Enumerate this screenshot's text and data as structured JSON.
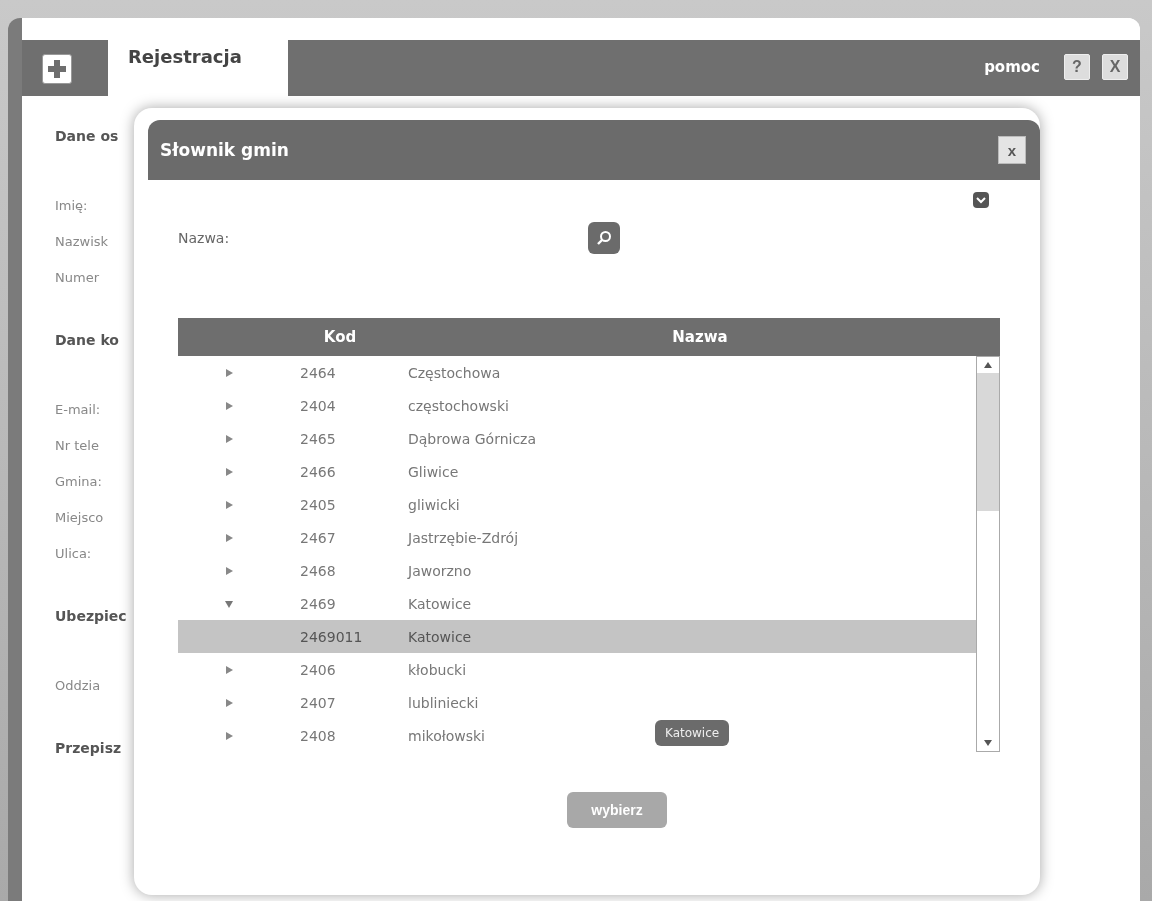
{
  "window": {
    "title": "Rejestracja",
    "help_link": "pomoc",
    "help_button": "?",
    "close_button": "X"
  },
  "form": {
    "sections": [
      {
        "heading": "Dane os",
        "labels": [
          "Imię:",
          "Nazwisk",
          "Numer"
        ]
      },
      {
        "heading": "Dane ko",
        "labels": [
          "E-mail:",
          "Nr tele",
          "Gmina:",
          "Miejsco",
          "Ulica:"
        ]
      },
      {
        "heading": "Ubezpiec",
        "labels": [
          "Oddzia"
        ]
      },
      {
        "heading": "Przepisz"
      }
    ]
  },
  "dialog": {
    "title": "Słownik gmin",
    "close_button": "x",
    "search": {
      "label": "Nazwa:"
    },
    "table": {
      "columns": [
        "",
        "Kod",
        "Nazwa"
      ],
      "rows": [
        {
          "code": "2464",
          "name": "Częstochowa",
          "expanded": false,
          "selected": false
        },
        {
          "code": "2404",
          "name": "częstochowski",
          "expanded": false,
          "selected": false
        },
        {
          "code": "2465",
          "name": "Dąbrowa Górnicza",
          "expanded": false,
          "selected": false
        },
        {
          "code": "2466",
          "name": "Gliwice",
          "expanded": false,
          "selected": false
        },
        {
          "code": "2405",
          "name": "gliwicki",
          "expanded": false,
          "selected": false
        },
        {
          "code": "2467",
          "name": "Jastrzębie-Zdrój",
          "expanded": false,
          "selected": false
        },
        {
          "code": "2468",
          "name": "Jaworzno",
          "expanded": false,
          "selected": false
        },
        {
          "code": "2469",
          "name": "Katowice",
          "expanded": true,
          "selected": false,
          "children": [
            {
              "code": "2469011",
              "name": "Katowice",
              "selected": true
            }
          ]
        },
        {
          "code": "2406",
          "name": "kłobucki",
          "expanded": false,
          "selected": false
        },
        {
          "code": "2407",
          "name": "lubliniecki",
          "expanded": false,
          "selected": false
        },
        {
          "code": "2408",
          "name": "mikołowski",
          "expanded": false,
          "selected": false
        }
      ]
    },
    "tooltip": "Katowice",
    "select_button": {
      "label": "wybierz",
      "disabled": true
    }
  }
}
